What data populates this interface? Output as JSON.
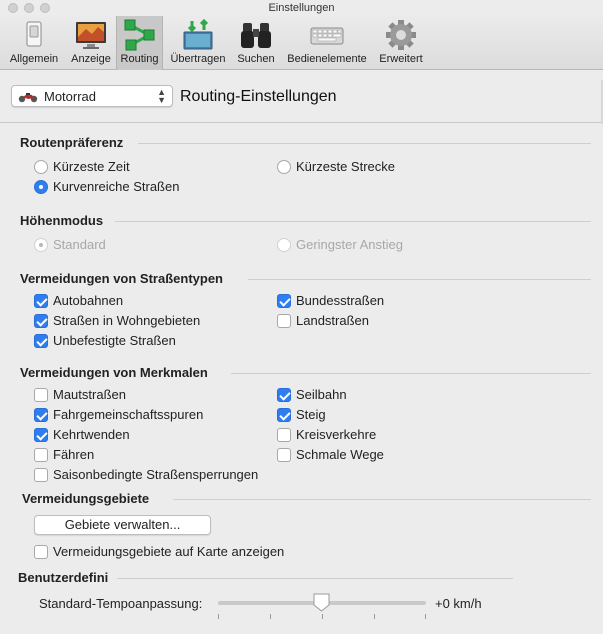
{
  "window": {
    "title": "Einstellungen"
  },
  "toolbar": {
    "items": [
      {
        "label": "Allgemein",
        "icon": "switch-icon"
      },
      {
        "label": "Anzeige",
        "icon": "display-icon"
      },
      {
        "label": "Routing",
        "icon": "routing-icon",
        "active": true
      },
      {
        "label": "Übertragen",
        "icon": "transfer-icon"
      },
      {
        "label": "Suchen",
        "icon": "binoculars-icon"
      },
      {
        "label": "Bedienelemente",
        "icon": "keyboard-icon"
      },
      {
        "label": "Erweitert",
        "icon": "gear-icon"
      }
    ]
  },
  "profile": {
    "selected": "Motorrad",
    "section_title": "Routing-Einstellungen"
  },
  "groups": {
    "route_pref": {
      "title": "Routenpräferenz",
      "options": [
        {
          "label": "Kürzeste Zeit",
          "checked": false
        },
        {
          "label": "Kürzeste Strecke",
          "checked": false
        },
        {
          "label": "Kurvenreiche Straßen",
          "checked": true
        }
      ]
    },
    "elevation": {
      "title": "Höhenmodus",
      "options": [
        {
          "label": "Standard",
          "checked": true,
          "disabled": true
        },
        {
          "label": "Geringster Anstieg",
          "checked": false,
          "disabled": true
        }
      ]
    },
    "road_types": {
      "title": "Vermeidungen von Straßentypen",
      "options": [
        {
          "label": "Autobahnen",
          "checked": true
        },
        {
          "label": "Bundesstraßen",
          "checked": true
        },
        {
          "label": "Straßen in Wohngebieten",
          "checked": true
        },
        {
          "label": "Landstraßen",
          "checked": false
        },
        {
          "label": "Unbefestigte Straßen",
          "checked": true
        }
      ]
    },
    "features": {
      "title": "Vermeidungen von Merkmalen",
      "options": [
        {
          "label": "Mautstraßen",
          "checked": false
        },
        {
          "label": "Seilbahn",
          "checked": true
        },
        {
          "label": "Fahrgemeinschaftsspuren",
          "checked": true
        },
        {
          "label": "Steig",
          "checked": true
        },
        {
          "label": "Kehrtwenden",
          "checked": true
        },
        {
          "label": "Kreisverkehre",
          "checked": false
        },
        {
          "label": "Fähren",
          "checked": false
        },
        {
          "label": "Schmale Wege",
          "checked": false
        },
        {
          "label": "Saisonbedingte Straßensperrungen",
          "checked": false
        }
      ]
    },
    "areas": {
      "title": "Vermeidungsgebiete",
      "manage_button": "Gebiete verwalten...",
      "show_on_map": {
        "label": "Vermeidungsgebiete auf Karte anzeigen",
        "checked": false
      }
    },
    "custom": {
      "title": "Benutzerdefini",
      "speed_label": "Standard-Tempoanpassung:",
      "speed_value": "+0 km/h",
      "speed_position": 0.5
    }
  },
  "colors": {
    "accent": "#2f7ef0",
    "window_bg": "#ececec"
  }
}
